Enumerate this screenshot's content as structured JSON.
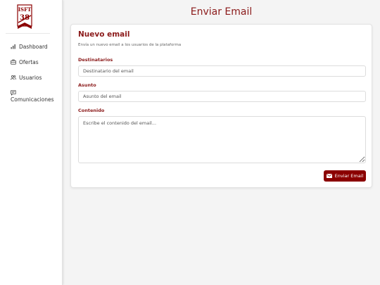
{
  "colors": {
    "accent": "#8b1a1a",
    "button": "#8b0000"
  },
  "logo": {
    "text": "ISFT 38",
    "icon": "institution-logo"
  },
  "sidebar": {
    "items": [
      {
        "label": "Dashboard",
        "icon": "bar-chart-icon"
      },
      {
        "label": "Ofertas",
        "icon": "briefcase-icon"
      },
      {
        "label": "Usuarios",
        "icon": "users-icon"
      },
      {
        "label": "Comunicaciones",
        "icon": "chat-icon"
      }
    ]
  },
  "page": {
    "title": "Enviar Email"
  },
  "card": {
    "title": "Nuevo email",
    "subtitle": "Envía un nuevo email a los usuarios de la plataforma"
  },
  "form": {
    "recipients": {
      "label": "Destinatarios",
      "placeholder": "Destinatario del email",
      "value": ""
    },
    "subject": {
      "label": "Asunto",
      "placeholder": "Asunto del email",
      "value": ""
    },
    "content": {
      "label": "Contenido",
      "placeholder": "Escribe el contenido del email...",
      "value": ""
    },
    "send_label": "Enviar Email",
    "send_icon": "envelope-icon"
  }
}
